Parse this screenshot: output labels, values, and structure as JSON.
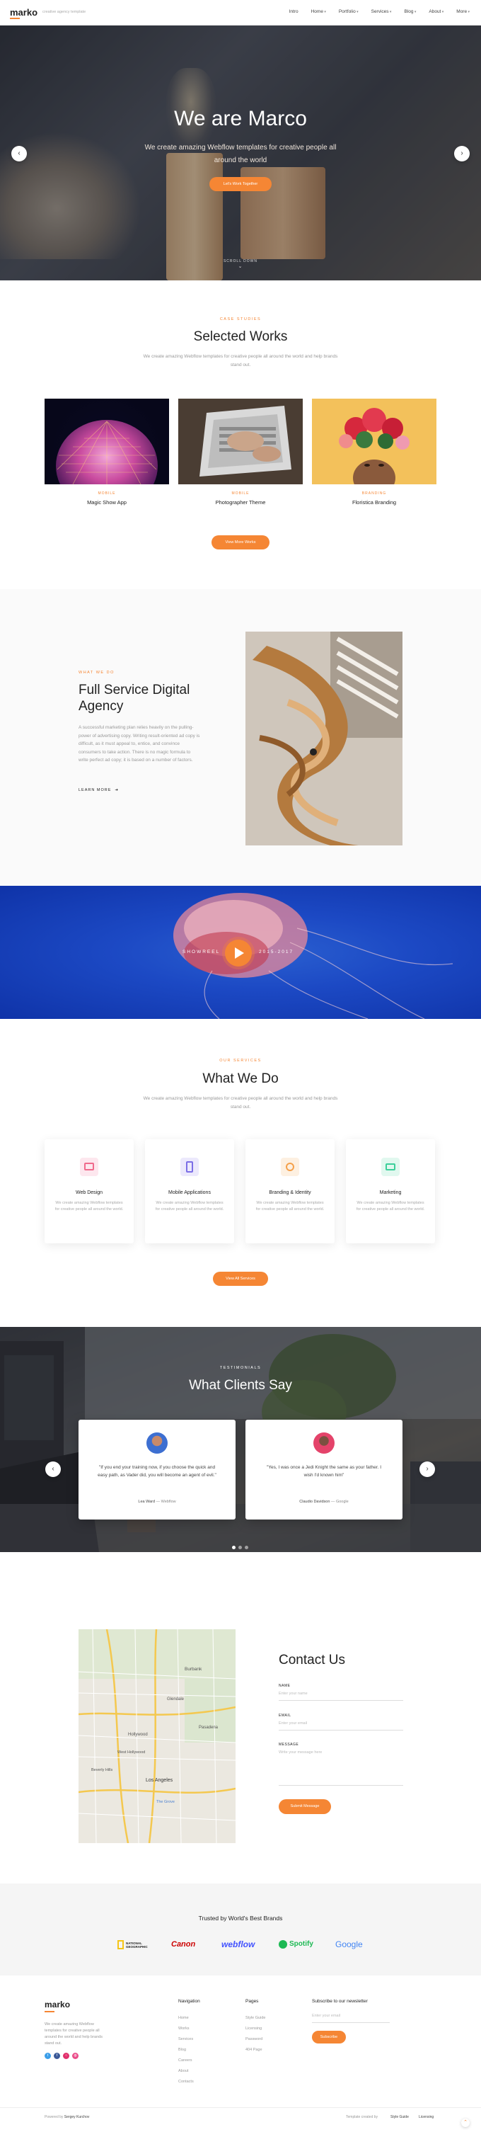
{
  "nav": {
    "logo": "marko",
    "tagline": "creative agency template",
    "links": [
      {
        "label": "Intro",
        "caret": false
      },
      {
        "label": "Home",
        "caret": true
      },
      {
        "label": "Portfolio",
        "caret": true
      },
      {
        "label": "Services",
        "caret": true
      },
      {
        "label": "Blog",
        "caret": true
      },
      {
        "label": "About",
        "caret": true
      },
      {
        "label": "More",
        "caret": true
      }
    ]
  },
  "hero": {
    "title": "We are Marco",
    "subtitle": "We create amazing Webflow templates for creative people all around the world",
    "button": "Let's Work Together",
    "scroll": "SCROLL DOWN",
    "prev_icon": "chevron-left-icon",
    "next_icon": "chevron-right-icon"
  },
  "works": {
    "kicker": "CASE STUDIES",
    "title": "Selected Works",
    "subtitle": "We create amazing Webflow templates for creative people all around the world and help brands stand out.",
    "items": [
      {
        "category": "MOBILE",
        "name": "Magic Show App"
      },
      {
        "category": "MOBILE",
        "name": "Photographer Theme"
      },
      {
        "category": "BRANDING",
        "name": "Floristica Branding"
      }
    ],
    "button": "View More Works"
  },
  "agency": {
    "kicker": "WHAT WE DO",
    "title": "Full Service Digital Agency",
    "body": "A successful marketing plan relies heavily on the pulling-power of advertising copy. Writing result-oriented ad copy is difficult, as it must appeal to, entice, and convince consumers to take action. There is no magic formula to write perfect ad copy; it is based on a number of factors.",
    "link": "LEARN MORE"
  },
  "showreel": {
    "left": "SHOWREEL",
    "right": "2015-2017",
    "play_icon": "play-icon"
  },
  "services": {
    "kicker": "OUR SERVICES",
    "title": "What We Do",
    "subtitle": "We create amazing Webflow templates for creative people all around the world and help brands stand out.",
    "items": [
      {
        "title": "Web Design",
        "desc": "We create amazing Webflow templates for creative people all around the world.",
        "icon": "web-design-icon",
        "color": "#f06a8c"
      },
      {
        "title": "Mobile Applications",
        "desc": "We create amazing Webflow templates for creative people all around the world.",
        "icon": "mobile-app-icon",
        "color": "#7b6ee6"
      },
      {
        "title": "Branding & Identity",
        "desc": "We create amazing Webflow templates for creative people all around the world.",
        "icon": "branding-icon",
        "color": "#f5a04a"
      },
      {
        "title": "Marketing",
        "desc": "We create amazing Webflow templates for creative people all around the world.",
        "icon": "marketing-icon",
        "color": "#3ccf9a"
      }
    ],
    "button": "View All Services"
  },
  "testimonials": {
    "kicker": "TESTIMONIALS",
    "title": "What Clients Say",
    "items": [
      {
        "quote": "\"If you end your training now, if you choose the quick and easy path, as Vader did, you will become an agent of evil.\"",
        "name": "Lea Ward",
        "company": "Webflow"
      },
      {
        "quote": "\"Yes, I was once a Jedi Knight the same as your father. I wish I'd known him\"",
        "name": "Claudio Davidson",
        "company": "Google"
      }
    ]
  },
  "contact": {
    "title": "Contact Us",
    "name_label": "NAME",
    "name_placeholder": "Enter your name",
    "email_label": "EMAIL",
    "email_placeholder": "Enter your email",
    "message_label": "MESSAGE",
    "message_placeholder": "Write your message here",
    "button": "Submit Message",
    "map_labels": [
      "Burbank",
      "Glendale",
      "Pasadena",
      "Hollywood",
      "Beverly Hills",
      "Los Angeles",
      "West Hollywood",
      "The Grove"
    ]
  },
  "brands": {
    "title": "Trusted by World's Best Brands",
    "items": [
      {
        "name": "NATIONAL GEOGRAPHIC",
        "color": "#222222"
      },
      {
        "name": "Canon",
        "color": "#cc0000"
      },
      {
        "name": "webflow",
        "color": "#4353ff"
      },
      {
        "name": "Spotify",
        "color": "#1db954"
      },
      {
        "name": "Google",
        "color": "#4285f4"
      }
    ]
  },
  "footer": {
    "logo": "marko",
    "about": "We create amazing Webflow templates for creative people all around the world and help brands stand out.",
    "col1_title": "Navigation",
    "col1": [
      "Home",
      "Works",
      "Services",
      "Blog",
      "Careers",
      "About",
      "Contacts"
    ],
    "col2_title": "Pages",
    "col2": [
      "Style Guide",
      "Licensing",
      "Password",
      "404 Page"
    ],
    "newsletter_title": "Subscribe to our newsletter",
    "newsletter_placeholder": "Enter your email",
    "newsletter_button": "Subscribe",
    "copyright_prefix": "Powered by",
    "copyright_link": "Sergey Kurchov",
    "bottom_left": "Template created by",
    "bottom_links": [
      "Style Guide",
      "Licensing"
    ]
  }
}
